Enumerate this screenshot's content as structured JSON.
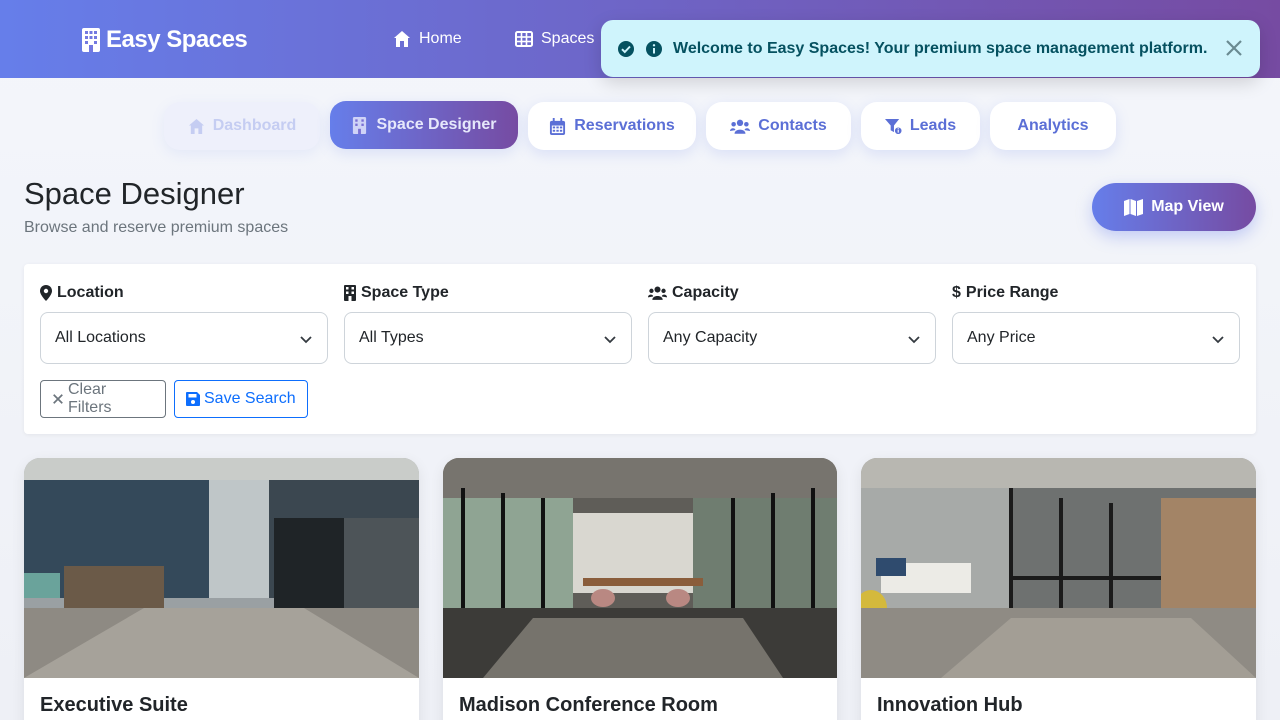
{
  "navbar": {
    "brand": "Easy Spaces",
    "links": [
      {
        "label": "Home",
        "icon": "home-icon"
      },
      {
        "label": "Spaces",
        "icon": "table-icon"
      }
    ]
  },
  "toast": {
    "message": "Welcome to Easy Spaces! Your premium space management platform.",
    "status_color": "#055160",
    "background_color": "#cff4fc"
  },
  "tabs": [
    {
      "label": "Dashboard",
      "icon": "home-icon",
      "state": "disabled"
    },
    {
      "label": "Space Designer",
      "icon": "building-icon",
      "state": "active"
    },
    {
      "label": "Reservations",
      "icon": "calendar-icon",
      "state": "default"
    },
    {
      "label": "Contacts",
      "icon": "users-icon",
      "state": "default"
    },
    {
      "label": "Leads",
      "icon": "funnel-icon",
      "state": "default"
    },
    {
      "label": "Analytics",
      "icon": "",
      "state": "default"
    }
  ],
  "header": {
    "title": "Space Designer",
    "subtitle": "Browse and reserve premium spaces",
    "map_button": "Map View"
  },
  "filters": {
    "location": {
      "label": "Location",
      "value": "All Locations"
    },
    "space_type": {
      "label": "Space Type",
      "value": "All Types"
    },
    "capacity": {
      "label": "Capacity",
      "value": "Any Capacity"
    },
    "price_range": {
      "label": "Price Range",
      "value": "Any Price"
    },
    "clear_button": "Clear Filters",
    "save_button": "Save Search"
  },
  "spaces": [
    {
      "name": "Executive Suite"
    },
    {
      "name": "Madison Conference Room"
    },
    {
      "name": "Innovation Hub"
    }
  ],
  "colors": {
    "accent_start": "#667eea",
    "accent_end": "#764ba2",
    "primary": "#0d6efd",
    "secondary": "#6c757d"
  }
}
